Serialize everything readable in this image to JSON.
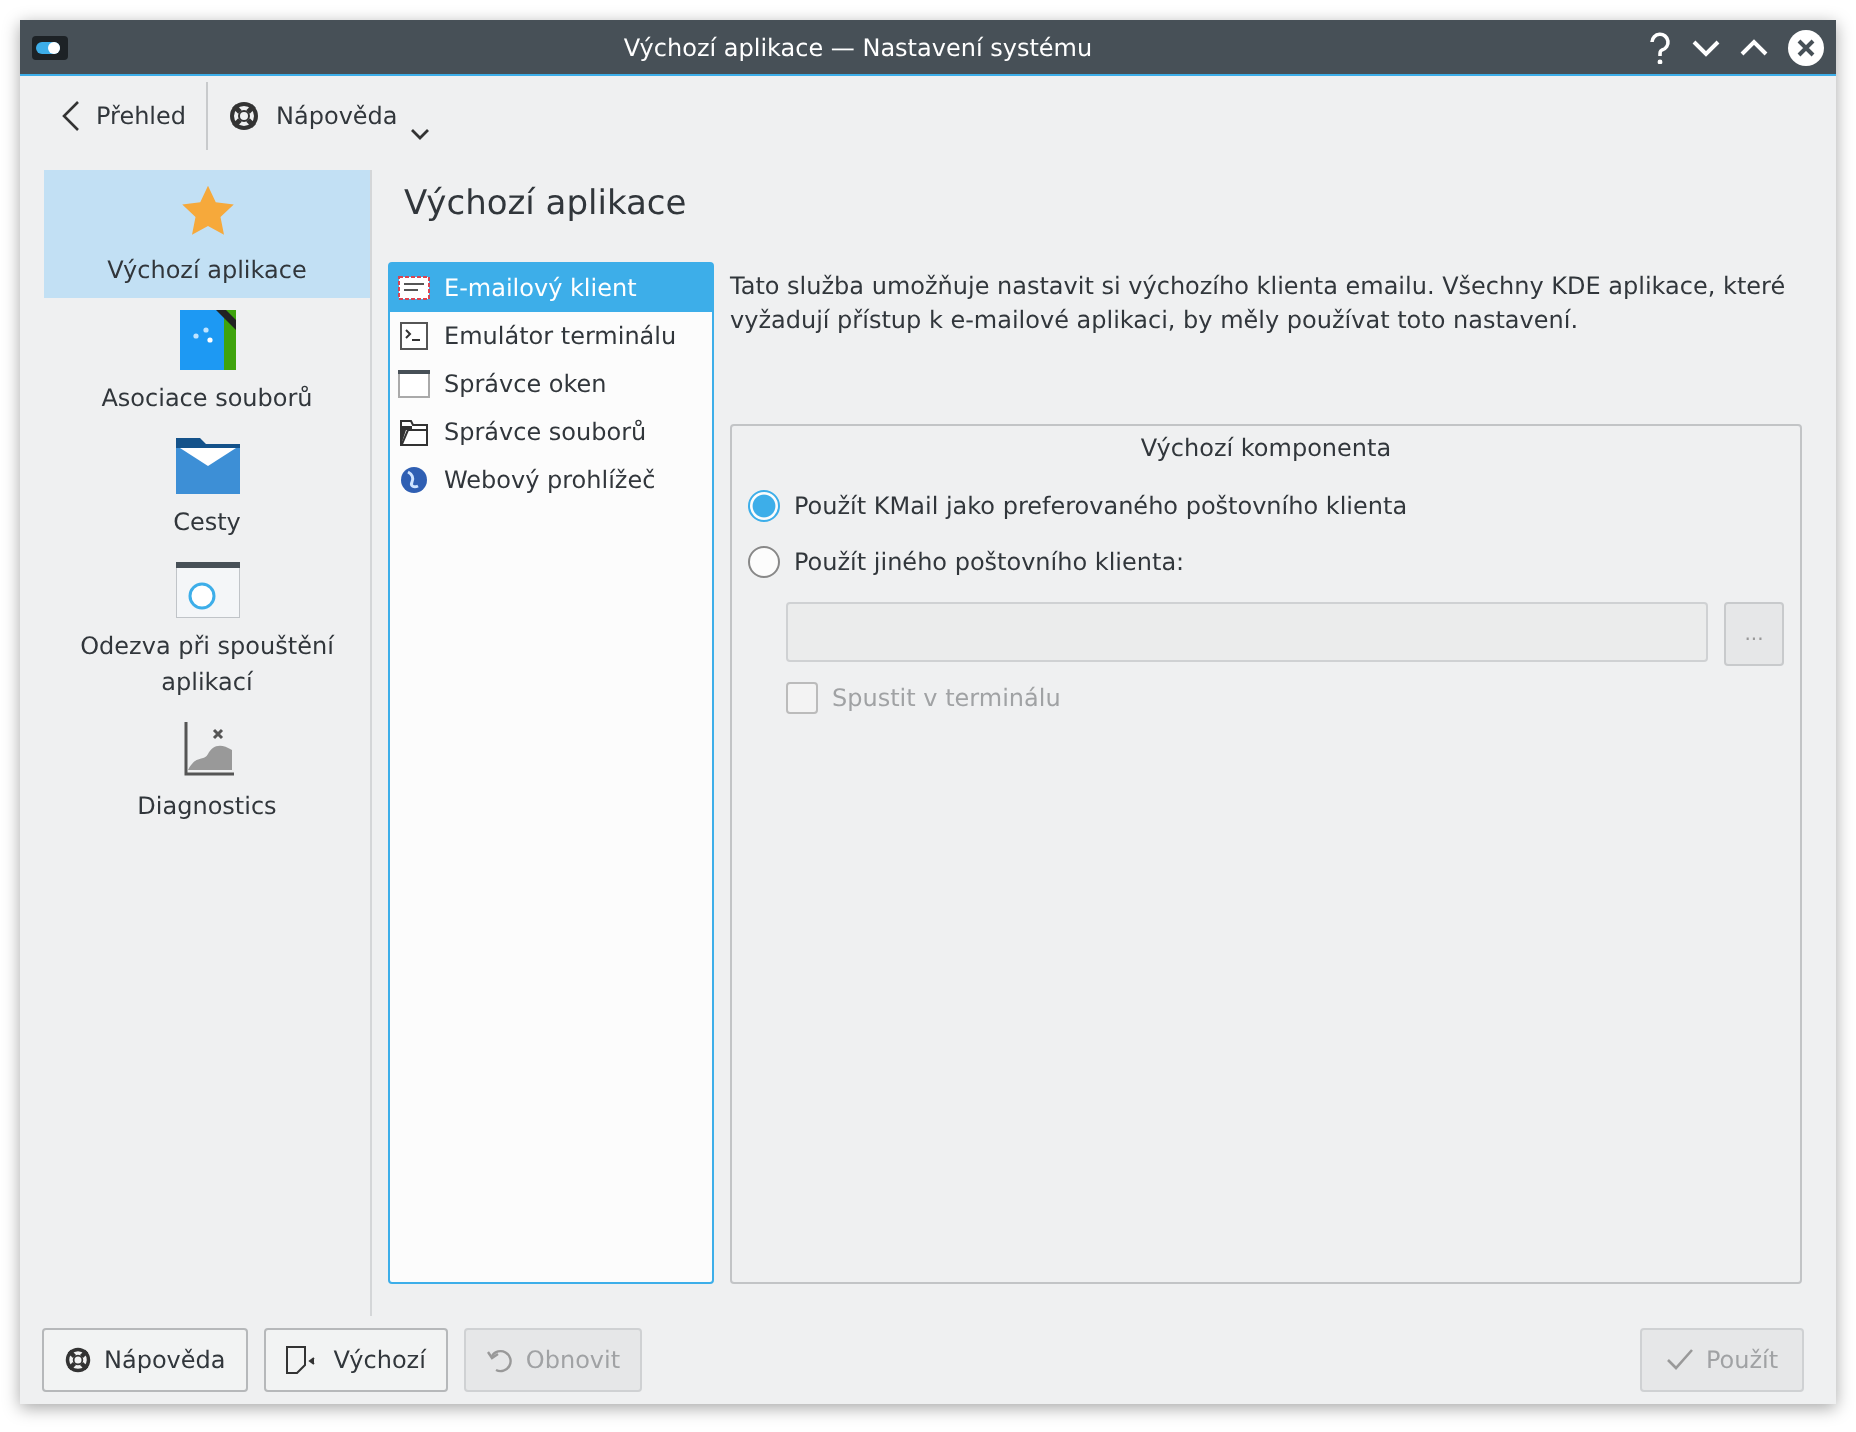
{
  "window": {
    "title": "Výchozí aplikace  — Nastavení systému"
  },
  "toolbar": {
    "back": {
      "label": "Přehled"
    },
    "help": {
      "label": "Nápověda"
    }
  },
  "sidebar": {
    "items": [
      {
        "label": "Výchozí aplikace",
        "kind": "star",
        "selected": true
      },
      {
        "label": "Asociace souborů",
        "kind": "file",
        "selected": false
      },
      {
        "label": "Cesty",
        "kind": "folder",
        "selected": false
      },
      {
        "label": "Odezva při spouštění aplikací",
        "kind": "window",
        "selected": false
      },
      {
        "label": "Diagnostics",
        "kind": "chart",
        "selected": false
      }
    ]
  },
  "page": {
    "title": "Výchozí aplikace",
    "components": [
      {
        "label": "E-mailový klient",
        "kind": "mail",
        "selected": true
      },
      {
        "label": "Emulátor terminálu",
        "kind": "terminal",
        "selected": false
      },
      {
        "label": "Správce oken",
        "kind": "window",
        "selected": false
      },
      {
        "label": "Správce souborů",
        "kind": "folder",
        "selected": false
      },
      {
        "label": "Webový prohlížeč",
        "kind": "globe",
        "selected": false
      }
    ],
    "description": "Tato služba umožňuje nastavit si výchozího klienta emailu. Všechny KDE aplikace, které vyžadují přístup k e-mailové aplikaci, by měly používat toto nastavení.",
    "group": {
      "title": "Výchozí komponenta",
      "options": [
        {
          "label": "Použít KMail jako preferovaného poštovního klienta",
          "selected": true
        },
        {
          "label": "Použít jiného poštovního klienta:",
          "selected": false
        }
      ],
      "command_field": {
        "disabled": true
      },
      "browse_button": {
        "label": "...",
        "disabled": true
      },
      "terminal_checkbox": {
        "label": "Spustit v terminálu",
        "checked": false,
        "disabled": true
      }
    }
  },
  "footer": {
    "buttons": [
      {
        "label": "Nápověda",
        "kind": "help",
        "disabled": false
      },
      {
        "label": "Výchozí",
        "kind": "defaults",
        "disabled": false
      },
      {
        "label": "Obnovit",
        "kind": "reset",
        "disabled": true
      },
      {
        "label": "Použít",
        "kind": "apply",
        "disabled": true
      }
    ]
  }
}
